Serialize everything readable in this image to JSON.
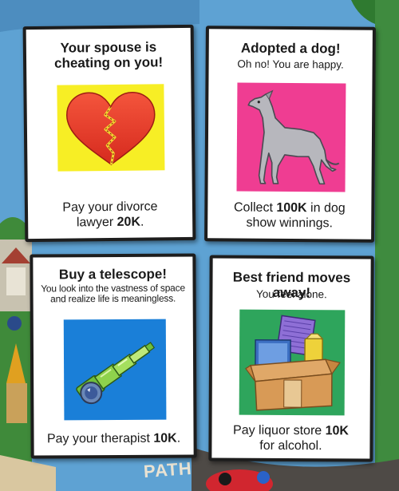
{
  "cards": [
    {
      "title": "Your spouse is cheating on you!",
      "subtitle": "",
      "icon": "broken-heart-icon",
      "icon_bg": "#f7ee25",
      "footer_pre": "Pay your divorce lawyer ",
      "footer_bold": "20K",
      "footer_post": "."
    },
    {
      "title": "Adopted a dog!",
      "subtitle": "Oh no! You are happy.",
      "icon": "greyhound-dog-icon",
      "icon_bg": "#ef3d92",
      "footer_pre": "Collect ",
      "footer_bold": "100K",
      "footer_post": " in dog show winnings."
    },
    {
      "title": "Buy a telescope!",
      "subtitle": "You look into the vastness of space and realize life is meaningless.",
      "icon": "telescope-icon",
      "icon_bg": "#1a7fd8",
      "footer_pre": "Pay your therapist ",
      "footer_bold": "10K",
      "footer_post": "."
    },
    {
      "title": "Best friend moves away!",
      "subtitle": "You feel alone.",
      "icon": "moving-box-icon",
      "icon_bg": "#2ea55c",
      "footer_pre": "Pay liquor store ",
      "footer_bold": "10K",
      "footer_post": " for alcohol."
    }
  ],
  "board": {
    "path_label": "PATH"
  }
}
